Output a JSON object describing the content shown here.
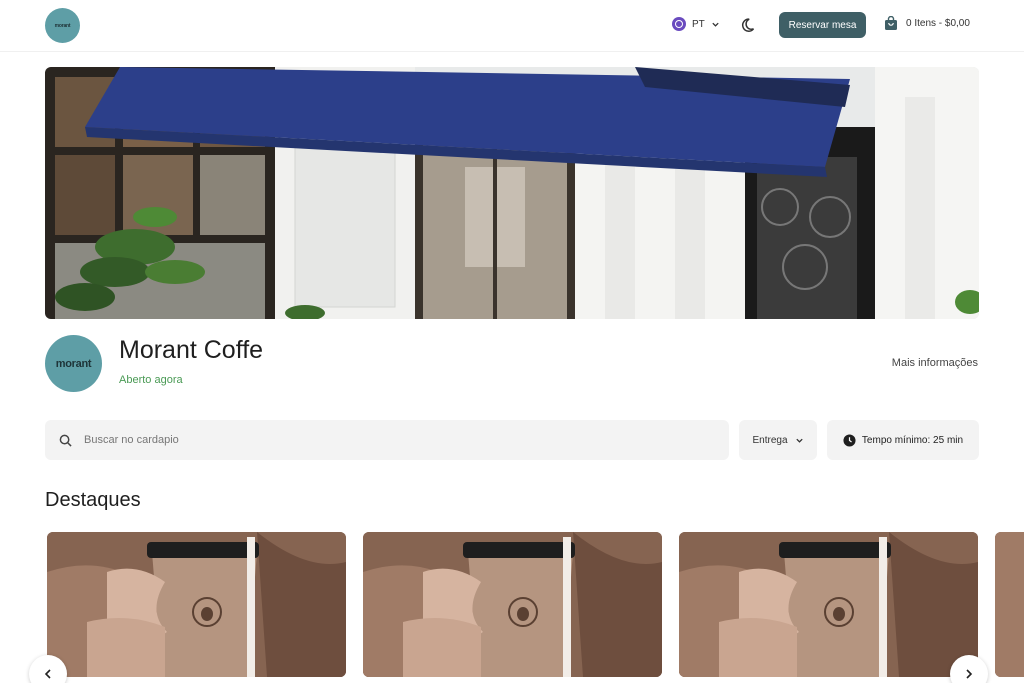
{
  "header": {
    "logo_text": "morant",
    "language": {
      "label": "PT",
      "icon": "globe-icon"
    },
    "theme_icon": "moon-icon",
    "reserve_button": "Reservar mesa",
    "cart": {
      "label": "0 Itens - $0,00",
      "icon": "shopping-bag-icon"
    }
  },
  "store": {
    "name": "Morant Coffe",
    "status": "Aberto agora",
    "logo_text": "morant",
    "more_info": "Mais informações"
  },
  "search": {
    "placeholder": "Buscar no cardapio",
    "icon": "search-icon"
  },
  "filters": {
    "delivery": "Entrega",
    "min_time": "Tempo mínimo: 25 min"
  },
  "highlights": {
    "title": "Destaques",
    "cards": 4
  },
  "colors": {
    "primary": "#3f5f66",
    "logo_bg": "#5e9ea6",
    "open_green": "#4a9a55",
    "awning_blue": "#2c3f8a",
    "card_brown": "#8d6a57"
  }
}
